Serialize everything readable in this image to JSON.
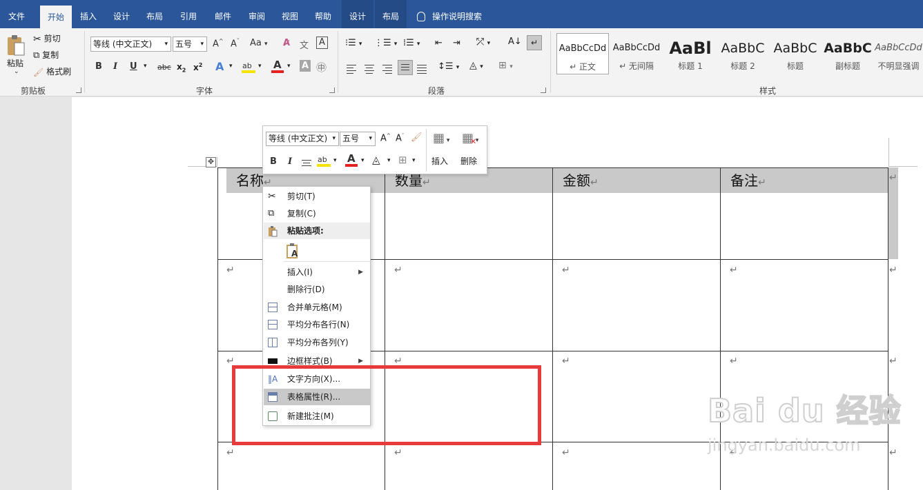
{
  "tabs": [
    "文件",
    "开始",
    "插入",
    "设计",
    "布局",
    "引用",
    "邮件",
    "审阅",
    "视图",
    "帮助",
    "设计",
    "布局"
  ],
  "tell_me": "操作说明搜索",
  "clipboard": {
    "paste": "粘贴",
    "cut": "剪切",
    "copy": "复制",
    "format_painter": "格式刷",
    "group": "剪贴板"
  },
  "font": {
    "name": "等线 (中文正文)",
    "size": "五号",
    "case_btn": "Aa",
    "group": "字体"
  },
  "paragraph": {
    "group": "段落"
  },
  "styles": {
    "group": "样式",
    "items": [
      {
        "preview": "AaBbCcDd",
        "name": "↵ 正文"
      },
      {
        "preview": "AaBbCcDd",
        "name": "↵ 无间隔"
      },
      {
        "preview": "AaBl",
        "name": "标题 1"
      },
      {
        "preview": "AaBbC",
        "name": "标题 2"
      },
      {
        "preview": "AaBbC",
        "name": "标题"
      },
      {
        "preview": "AaBbC",
        "name": "副标题"
      },
      {
        "preview": "AaBbCcDd",
        "name": "不明显强调"
      }
    ]
  },
  "table": {
    "headers": [
      "名称",
      "数量",
      "金额",
      "备注"
    ],
    "mark": "↵"
  },
  "mini_toolbar": {
    "font": "等线 (中文正文)",
    "size": "五号",
    "insert": "插入",
    "delete": "删除"
  },
  "context_menu": {
    "items": [
      {
        "label": "剪切(T)",
        "icon": "scissors-icon"
      },
      {
        "label": "复制(C)",
        "icon": "copy-icon"
      },
      {
        "label": "粘贴选项:",
        "icon": "paste-icon"
      },
      {
        "label": "插入(I)",
        "icon": ""
      },
      {
        "label": "删除行(D)",
        "icon": ""
      },
      {
        "label": "合并单元格(M)",
        "icon": "merge-cells-icon"
      },
      {
        "label": "平均分布各行(N)",
        "icon": "distribute-rows-icon"
      },
      {
        "label": "平均分布各列(Y)",
        "icon": "distribute-columns-icon"
      },
      {
        "label": "边框样式(B)",
        "icon": "border-style-icon"
      },
      {
        "label": "文字方向(X)...",
        "icon": "text-direction-icon"
      },
      {
        "label": "表格属性(R)...",
        "icon": "table-properties-icon"
      },
      {
        "label": "新建批注(M)",
        "icon": "new-comment-icon"
      }
    ]
  },
  "watermark": {
    "brand": "Bai du 经验",
    "url": "jingyan.baidu.com"
  },
  "colors": {
    "ribbon_blue": "#2b579a",
    "highlight_red": "#e83a3a",
    "header_gray": "#c9c9c9"
  }
}
